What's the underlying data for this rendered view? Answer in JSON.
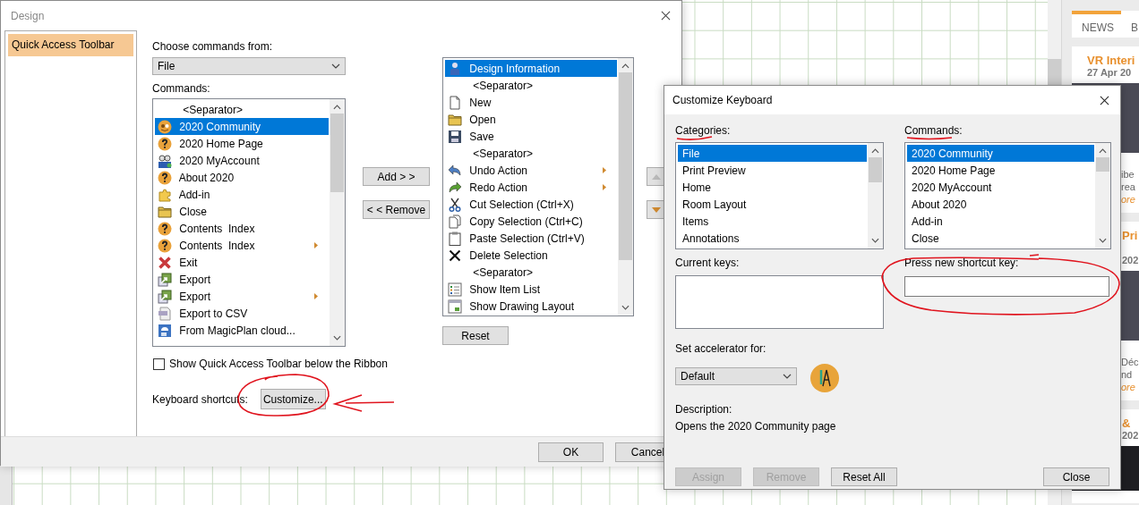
{
  "design_dialog": {
    "title": "Design",
    "nav": [
      {
        "label": "Quick Access Toolbar",
        "selected": true
      }
    ],
    "choose_label": "Choose commands from:",
    "choose_value": "File",
    "commands_label": "Commands:",
    "commands": [
      {
        "label": "<Separator>",
        "kind": "separator",
        "selected": false,
        "submenu": false
      },
      {
        "label": "2020 Community",
        "kind": "community",
        "selected": true,
        "submenu": false
      },
      {
        "label": "2020 Home Page",
        "kind": "question",
        "selected": false,
        "submenu": false
      },
      {
        "label": "2020 MyAccount",
        "kind": "people",
        "selected": false,
        "submenu": false
      },
      {
        "label": "About 2020",
        "kind": "question",
        "selected": false,
        "submenu": false
      },
      {
        "label": "Add-in",
        "kind": "puzzle",
        "selected": false,
        "submenu": false
      },
      {
        "label": "Close",
        "kind": "folder",
        "selected": false,
        "submenu": false
      },
      {
        "label": "Contents  Index",
        "kind": "question",
        "selected": false,
        "submenu": false
      },
      {
        "label": "Contents  Index",
        "kind": "question",
        "selected": false,
        "submenu": true
      },
      {
        "label": "Exit",
        "kind": "exit",
        "selected": false,
        "submenu": false
      },
      {
        "label": "Export",
        "kind": "export",
        "selected": false,
        "submenu": false
      },
      {
        "label": "Export",
        "kind": "export",
        "selected": false,
        "submenu": true
      },
      {
        "label": "Export to CSV",
        "kind": "csv",
        "selected": false,
        "submenu": false
      },
      {
        "label": "From MagicPlan cloud...",
        "kind": "cloud",
        "selected": false,
        "submenu": false
      }
    ],
    "add_button": "Add > >",
    "remove_button": "< < Remove",
    "toolbar_items": [
      {
        "label": "Design Information",
        "kind": "person",
        "selected": true,
        "submenu": false
      },
      {
        "label": "<Separator>",
        "kind": "separator",
        "selected": false,
        "submenu": false
      },
      {
        "label": "New",
        "kind": "document",
        "selected": false,
        "submenu": false
      },
      {
        "label": "Open",
        "kind": "open",
        "selected": false,
        "submenu": false
      },
      {
        "label": "Save",
        "kind": "save",
        "selected": false,
        "submenu": false
      },
      {
        "label": "<Separator>",
        "kind": "separator",
        "selected": false,
        "submenu": false
      },
      {
        "label": "Undo Action",
        "kind": "undo",
        "selected": false,
        "submenu": true
      },
      {
        "label": "Redo Action",
        "kind": "redo",
        "selected": false,
        "submenu": true
      },
      {
        "label": "Cut Selection (Ctrl+X)",
        "kind": "scissors",
        "selected": false,
        "submenu": false
      },
      {
        "label": "Copy Selection (Ctrl+C)",
        "kind": "copy",
        "selected": false,
        "submenu": false
      },
      {
        "label": "Paste Selection (Ctrl+V)",
        "kind": "paste",
        "selected": false,
        "submenu": false
      },
      {
        "label": "Delete Selection",
        "kind": "delete",
        "selected": false,
        "submenu": false
      },
      {
        "label": "<Separator>",
        "kind": "separator",
        "selected": false,
        "submenu": false
      },
      {
        "label": "Show Item List",
        "kind": "list",
        "selected": false,
        "submenu": false
      },
      {
        "label": "Show Drawing Layout",
        "kind": "layout",
        "selected": false,
        "submenu": false
      }
    ],
    "reset_button": "Reset",
    "show_below_ribbon": {
      "label": "Show Quick Access Toolbar below the Ribbon",
      "checked": false
    },
    "shortcuts_label": "Keyboard shortcuts:",
    "customize_button": "Customize...",
    "buttons": [
      "OK",
      "Cancel"
    ]
  },
  "keyboard_dialog": {
    "title": "Customize Keyboard",
    "categories_label": "Categories:",
    "categories": [
      {
        "label": "File",
        "selected": true
      },
      {
        "label": "Print Preview",
        "selected": false
      },
      {
        "label": "Home",
        "selected": false
      },
      {
        "label": "Room Layout",
        "selected": false
      },
      {
        "label": "Items",
        "selected": false
      },
      {
        "label": "Annotations",
        "selected": false
      }
    ],
    "commands_label": "Commands:",
    "commands": [
      {
        "label": "2020 Community",
        "selected": true
      },
      {
        "label": "2020 Home Page",
        "selected": false
      },
      {
        "label": "2020 MyAccount",
        "selected": false
      },
      {
        "label": "About 2020",
        "selected": false
      },
      {
        "label": "Add-in",
        "selected": false
      },
      {
        "label": "Close",
        "selected": false
      }
    ],
    "current_keys_label": "Current keys:",
    "new_key_label": "Press new shortcut key:",
    "accelerator_label": "Set accelerator for:",
    "accelerator_value": "Default",
    "description_label": "Description:",
    "description": "Opens the 2020 Community page",
    "buttons": [
      {
        "label": "Assign",
        "disabled": true
      },
      {
        "label": "Remove",
        "disabled": true
      },
      {
        "label": "Reset All",
        "disabled": false
      },
      {
        "label": "Close",
        "disabled": false
      }
    ]
  },
  "news_panel": {
    "tabs": [
      {
        "label": "NEWS",
        "selected": true
      },
      {
        "label": "B",
        "selected": false
      }
    ],
    "cards": [
      {
        "title": "VR Interi",
        "date": "27 Apr 20",
        "lines": [
          "ibe",
          "rea"
        ],
        "link": "ore"
      },
      {
        "title": "Pri",
        "date": "202",
        "lines": [
          "Déc",
          "nd"
        ],
        "link": "ore"
      },
      {
        "title": "&",
        "date": "202"
      }
    ]
  }
}
